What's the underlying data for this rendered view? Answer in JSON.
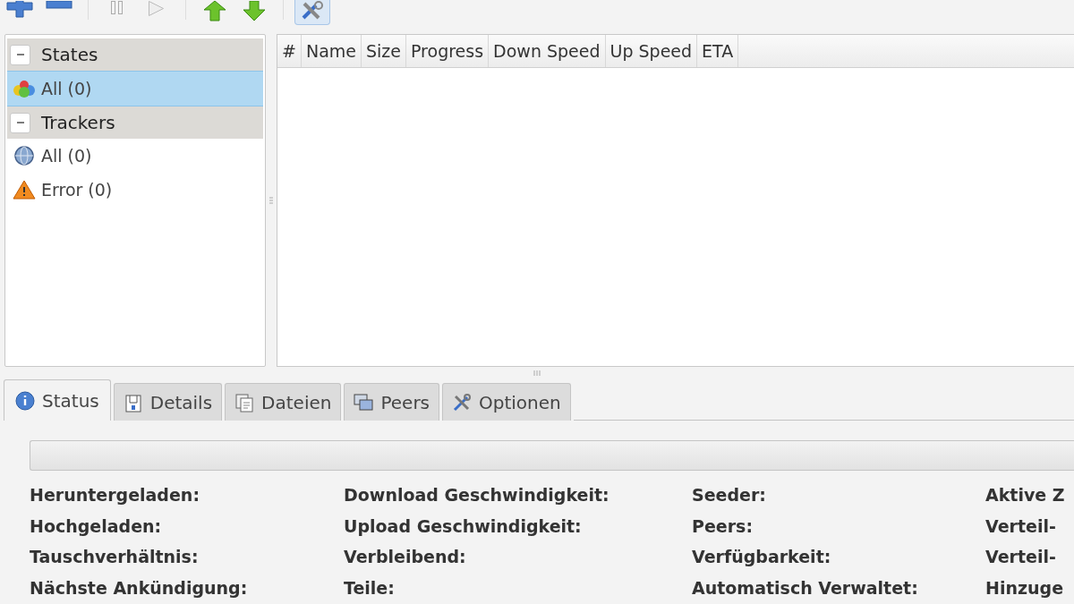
{
  "toolbar": {
    "buttons": [
      {
        "kind": "add",
        "selected": false
      },
      {
        "kind": "remove",
        "selected": false
      },
      {
        "kind": "pause",
        "selected": false
      },
      {
        "kind": "resume",
        "selected": false
      },
      {
        "kind": "up",
        "selected": false
      },
      {
        "kind": "down",
        "selected": false
      },
      {
        "kind": "preferences",
        "selected": true
      }
    ]
  },
  "sidebar": {
    "groups": [
      {
        "label": "States",
        "expanded": true,
        "items": [
          {
            "label": "All (0)",
            "kind": "all",
            "selected": true
          }
        ]
      },
      {
        "label": "Trackers",
        "expanded": true,
        "items": [
          {
            "label": "All (0)",
            "kind": "globe",
            "selected": false
          },
          {
            "label": "Error (0)",
            "kind": "warning",
            "selected": false
          }
        ]
      }
    ]
  },
  "table": {
    "columns": [
      "#",
      "Name",
      "Size",
      "Progress",
      "Down Speed",
      "Up Speed",
      "ETA"
    ]
  },
  "tabs": [
    {
      "label": "Status",
      "kind": "info",
      "selected": true
    },
    {
      "label": "Details",
      "kind": "details",
      "selected": false
    },
    {
      "label": "Dateien",
      "kind": "files",
      "selected": false
    },
    {
      "label": "Peers",
      "kind": "peers",
      "selected": false
    },
    {
      "label": "Optionen",
      "kind": "options",
      "selected": false
    }
  ],
  "status": {
    "progress": {
      "level": 0
    },
    "columns": [
      [
        "Heruntergeladen:",
        "Hochgeladen:",
        "Tauschverhältnis:",
        "Nächste Ankündigung:"
      ],
      [
        "Download Geschwindigkeit:",
        "Upload Geschwindigkeit:",
        "Verbleibend:",
        "Teile:"
      ],
      [
        "Seeder:",
        "Peers:",
        "Verfügbarkeit:",
        "Automatisch Verwaltet:"
      ],
      [
        "Aktive Z",
        "Verteil-",
        "Verteil-",
        "Hinzuge"
      ]
    ]
  }
}
